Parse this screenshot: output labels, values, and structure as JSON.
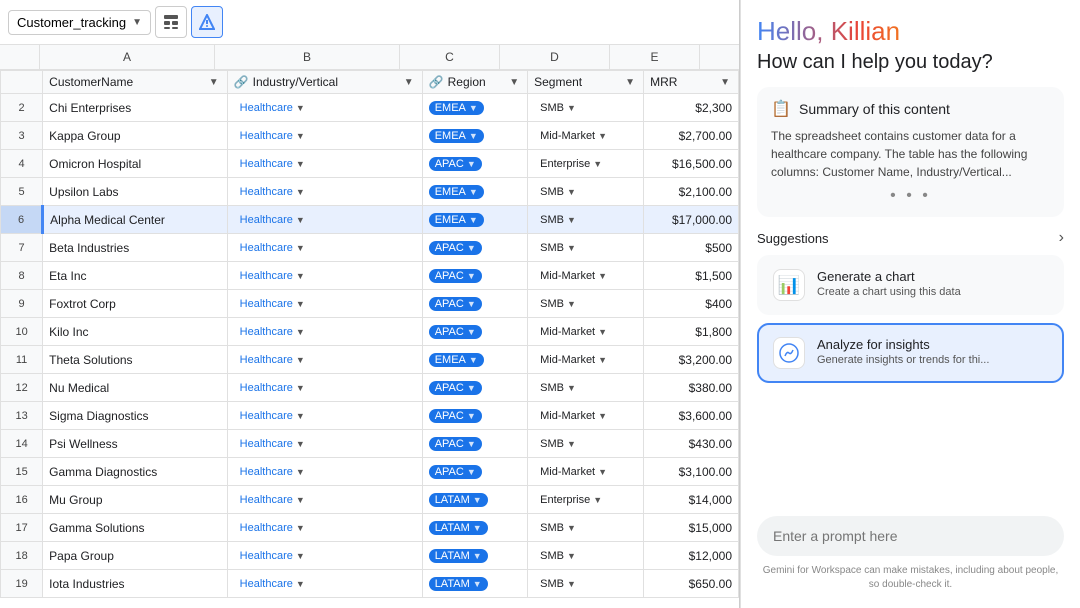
{
  "sheet": {
    "tab_name": "Customer_tracking",
    "col_letters": [
      "",
      "A",
      "B",
      "C",
      "D",
      "E"
    ],
    "headers": [
      "",
      "CustomerName",
      "Industry/Vertical",
      "Region",
      "Segment",
      "MRR"
    ],
    "rows": [
      {
        "num": 2,
        "name": "Chi Enterprises",
        "industry": "Healthcare",
        "region": "EMEA",
        "segment": "SMB",
        "mrr": "$2,300",
        "selected": false
      },
      {
        "num": 3,
        "name": "Kappa Group",
        "industry": "Healthcare",
        "region": "EMEA",
        "segment": "Mid-Market",
        "mrr": "$2,700.00",
        "selected": false
      },
      {
        "num": 4,
        "name": "Omicron Hospital",
        "industry": "Healthcare",
        "region": "APAC",
        "segment": "Enterprise",
        "mrr": "$16,500.00",
        "selected": false
      },
      {
        "num": 5,
        "name": "Upsilon Labs",
        "industry": "Healthcare",
        "region": "EMEA",
        "segment": "SMB",
        "mrr": "$2,100.00",
        "selected": false
      },
      {
        "num": 6,
        "name": "Alpha Medical Center",
        "industry": "Healthcare",
        "region": "EMEA",
        "segment": "SMB",
        "mrr": "$17,000.00",
        "selected": true
      },
      {
        "num": 7,
        "name": "Beta Industries",
        "industry": "Healthcare",
        "region": "APAC",
        "segment": "SMB",
        "mrr": "$500",
        "selected": false
      },
      {
        "num": 8,
        "name": "Eta Inc",
        "industry": "Healthcare",
        "region": "APAC",
        "segment": "Mid-Market",
        "mrr": "$1,500",
        "selected": false
      },
      {
        "num": 9,
        "name": "Foxtrot Corp",
        "industry": "Healthcare",
        "region": "APAC",
        "segment": "SMB",
        "mrr": "$400",
        "selected": false
      },
      {
        "num": 10,
        "name": "Kilo Inc",
        "industry": "Healthcare",
        "region": "APAC",
        "segment": "Mid-Market",
        "mrr": "$1,800",
        "selected": false
      },
      {
        "num": 11,
        "name": "Theta Solutions",
        "industry": "Healthcare",
        "region": "EMEA",
        "segment": "Mid-Market",
        "mrr": "$3,200.00",
        "selected": false
      },
      {
        "num": 12,
        "name": "Nu Medical",
        "industry": "Healthcare",
        "region": "APAC",
        "segment": "SMB",
        "mrr": "$380.00",
        "selected": false
      },
      {
        "num": 13,
        "name": "Sigma Diagnostics",
        "industry": "Healthcare",
        "region": "APAC",
        "segment": "Mid-Market",
        "mrr": "$3,600.00",
        "selected": false
      },
      {
        "num": 14,
        "name": "Psi Wellness",
        "industry": "Healthcare",
        "region": "APAC",
        "segment": "SMB",
        "mrr": "$430.00",
        "selected": false
      },
      {
        "num": 15,
        "name": "Gamma Diagnostics",
        "industry": "Healthcare",
        "region": "APAC",
        "segment": "Mid-Market",
        "mrr": "$3,100.00",
        "selected": false
      },
      {
        "num": 16,
        "name": "Mu Group",
        "industry": "Healthcare",
        "region": "LATAM",
        "segment": "Enterprise",
        "mrr": "$14,000",
        "selected": false
      },
      {
        "num": 17,
        "name": "Gamma Solutions",
        "industry": "Healthcare",
        "region": "LATAM",
        "segment": "SMB",
        "mrr": "$15,000",
        "selected": false
      },
      {
        "num": 18,
        "name": "Papa Group",
        "industry": "Healthcare",
        "region": "LATAM",
        "segment": "SMB",
        "mrr": "$12,000",
        "selected": false
      },
      {
        "num": 19,
        "name": "Iota Industries",
        "industry": "Healthcare",
        "region": "LATAM",
        "segment": "SMB",
        "mrr": "$650.00",
        "selected": false
      }
    ]
  },
  "gemini": {
    "greeting": "Hello, Killian",
    "subtitle": "How can I help you today?",
    "summary": {
      "icon": "📋",
      "title": "Summary of this content",
      "text": "The spreadsheet contains customer data for a healthcare company. The table has the following columns: Customer Name, Industry/Vertical..."
    },
    "suggestions_label": "Suggestions",
    "suggestions": [
      {
        "icon": "📊",
        "title": "Generate a chart",
        "desc": "Create a chart using this data",
        "active": false
      },
      {
        "icon": "🔍",
        "title": "Analyze for insights",
        "desc": "Generate insights or trends for thi...",
        "active": true
      }
    ],
    "prompt_placeholder": "Enter a prompt here",
    "disclaimer": "Gemini for Workspace can make mistakes, including about people, so double-check it."
  }
}
